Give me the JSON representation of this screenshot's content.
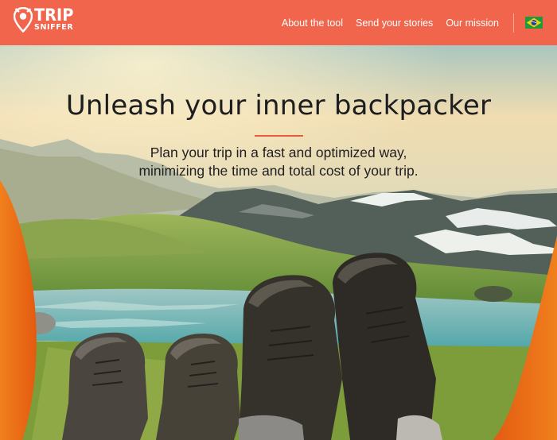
{
  "logo": {
    "line1": "TRIP",
    "line2": "SNIFFER",
    "icon": "location-pin-icon"
  },
  "nav": {
    "links": [
      "About the tool",
      "Send your stories",
      "Our mission"
    ],
    "language_flag": "brazil-flag-icon"
  },
  "hero": {
    "title": "Unleash your inner backpacker",
    "subtitle_line1": "Plan your trip in a fast and optimized way,",
    "subtitle_line2": "minimizing the time and total cost of your trip.",
    "image": "hiking-boots-mountain-lake-photo"
  },
  "colors": {
    "header": "#f0654c",
    "accent": "#e85a3e",
    "text": "#1d1d1f"
  }
}
